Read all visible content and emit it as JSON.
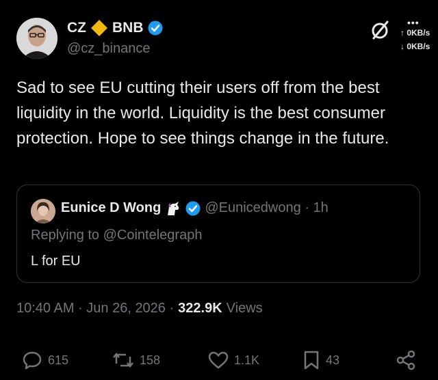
{
  "author": {
    "display_name": "CZ",
    "affiliation": "BNB",
    "handle": "@cz_binance"
  },
  "status_bar": {
    "dots": "•••",
    "upload": "↑ 0KB/s",
    "download": "↓ 0KB/s"
  },
  "tweet": {
    "text": "Sad to see EU cutting their users off from the best liquidity in the world. Liquidity is the best consumer protection. Hope to see things change in the future."
  },
  "quoted": {
    "name": "Eunice D Wong",
    "handle_time": "@Eunicedwong · 1h",
    "replying": "Replying to @Cointelegraph",
    "text": "L for EU"
  },
  "meta": {
    "time_date": "10:40 AM · Jun 26, 2026 ·",
    "views_count": "322.9K",
    "views_label": "Views"
  },
  "actions": {
    "replies": "615",
    "reposts": "158",
    "likes": "1.1K",
    "bookmarks": "43"
  },
  "colors": {
    "verified": "#1d9bf0",
    "binance": "#f0b90b",
    "muted": "#71767b",
    "text": "#e7e9ea"
  }
}
